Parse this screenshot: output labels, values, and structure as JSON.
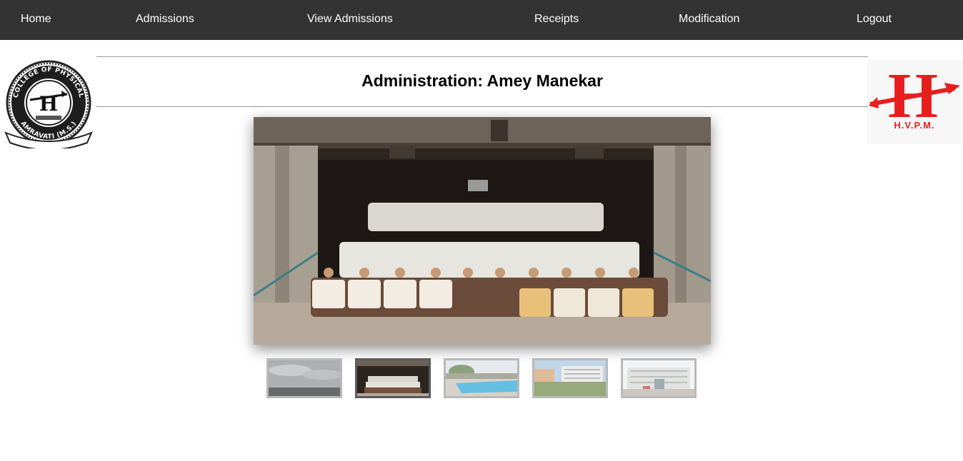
{
  "nav": {
    "home": "Home",
    "admissions": "Admissions",
    "view_admissions": "View Admissions",
    "receipts": "Receipts",
    "modification": "Modification",
    "logout": "Logout"
  },
  "page": {
    "title": "Administration: Amey Manekar"
  },
  "logos": {
    "left_text": "DEGREE COLLEGE OF PHYSICAL EDUCATION AMRAVATI (M.S.)",
    "right_text": "H.V.P.M."
  },
  "gallery": {
    "active_index": 1,
    "thumbnails": [
      {
        "icon": "sky-thumbnail-icon"
      },
      {
        "icon": "group-photo-thumbnail-icon"
      },
      {
        "icon": "swimming-pool-thumbnail-icon"
      },
      {
        "icon": "campus-building-thumbnail-icon"
      },
      {
        "icon": "college-building-thumbnail-icon"
      }
    ]
  },
  "colors": {
    "navbar": "#333333",
    "nav_text": "#ffffff",
    "hvpm_red": "#e81e1e"
  }
}
